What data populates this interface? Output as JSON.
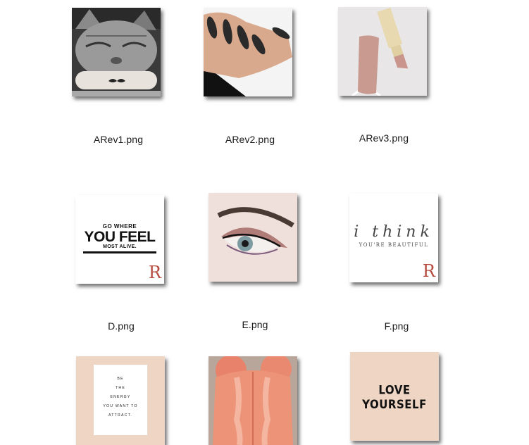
{
  "files": [
    {
      "name": "ARev1.png"
    },
    {
      "name": "ARev2.png"
    },
    {
      "name": "ARev3.png"
    },
    {
      "name": "D.png",
      "quote": {
        "line1": "GO WHERE",
        "line2": "YOU FEEL",
        "line3": "MOST ALIVE.",
        "logo": "R"
      }
    },
    {
      "name": "E.png"
    },
    {
      "name": "F.png",
      "quote": {
        "line1": "i think",
        "line2": "YOU'RE BEAUTIFUL",
        "logo": "R"
      }
    },
    {
      "quote": {
        "text": "BE\nTHE\nENERGY\nYOU WANT TO\nATTRACT."
      }
    },
    {},
    {
      "quote": {
        "text": "LOVE YOURSELF"
      }
    }
  ],
  "colors": {
    "nude": "#f2d8c8",
    "peach_bg": "#efd5c3",
    "hair": "#e8826a",
    "logo_red": "#b64b3f"
  }
}
